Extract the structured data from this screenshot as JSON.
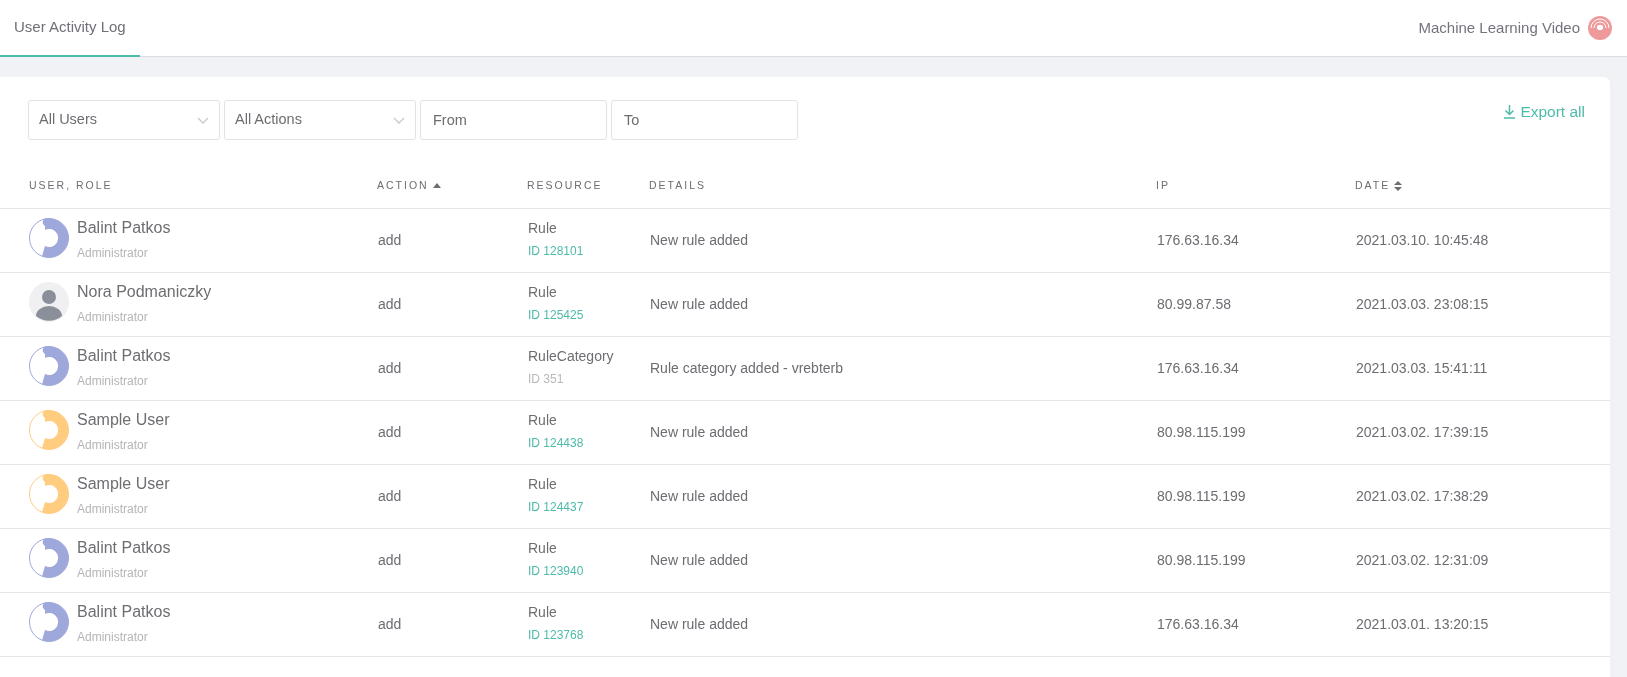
{
  "tabs": [
    {
      "label": "User Activity Log",
      "selected": true
    }
  ],
  "account": {
    "name": "Machine Learning Video"
  },
  "filters": {
    "user_select": "All Users",
    "action_select": "All Actions",
    "from": {
      "placeholder": "From"
    },
    "to": {
      "placeholder": "To"
    }
  },
  "export": {
    "label": "Export all"
  },
  "table": {
    "columns": [
      {
        "label": "USER, ROLE"
      },
      {
        "label": "ACTION",
        "sorted_asc": true
      },
      {
        "label": "RESOURCE"
      },
      {
        "label": "DETAILS"
      },
      {
        "label": "IP"
      },
      {
        "label": "DATE",
        "sortable": true
      }
    ],
    "rows": [
      {
        "avatar": {
          "kind": "pattern",
          "color": "#9fa8da"
        },
        "name": "Balint Patkos",
        "role": "Administrator",
        "action": "add",
        "resource": "Rule",
        "resource_id": "ID 128101",
        "id_linked": true,
        "details": "New rule added",
        "ip": "176.63.16.34",
        "date": "2021.03.10. 10:45:48"
      },
      {
        "avatar": {
          "kind": "photo",
          "color": "#8a8f99"
        },
        "name": "Nora Podmaniczky",
        "role": "Administrator",
        "action": "add",
        "resource": "Rule",
        "resource_id": "ID 125425",
        "id_linked": true,
        "details": "New rule added",
        "ip": "80.99.87.58",
        "date": "2021.03.03. 23:08:15"
      },
      {
        "avatar": {
          "kind": "pattern",
          "color": "#9fa8da"
        },
        "name": "Balint Patkos",
        "role": "Administrator",
        "action": "add",
        "resource": "RuleCategory",
        "resource_id": "ID 351",
        "id_linked": false,
        "details": "Rule category added - vrebterb",
        "ip": "176.63.16.34",
        "date": "2021.03.03. 15:41:11"
      },
      {
        "avatar": {
          "kind": "pattern",
          "color": "#ffcc80"
        },
        "name": "Sample User",
        "role": "Administrator",
        "action": "add",
        "resource": "Rule",
        "resource_id": "ID 124438",
        "id_linked": true,
        "details": "New rule added",
        "ip": "80.98.115.199",
        "date": "2021.03.02. 17:39:15"
      },
      {
        "avatar": {
          "kind": "pattern",
          "color": "#ffcc80"
        },
        "name": "Sample User",
        "role": "Administrator",
        "action": "add",
        "resource": "Rule",
        "resource_id": "ID 124437",
        "id_linked": true,
        "details": "New rule added",
        "ip": "80.98.115.199",
        "date": "2021.03.02. 17:38:29"
      },
      {
        "avatar": {
          "kind": "pattern",
          "color": "#9fa8da"
        },
        "name": "Balint Patkos",
        "role": "Administrator",
        "action": "add",
        "resource": "Rule",
        "resource_id": "ID 123940",
        "id_linked": true,
        "details": "New rule added",
        "ip": "80.98.115.199",
        "date": "2021.03.02. 12:31:09"
      },
      {
        "avatar": {
          "kind": "pattern",
          "color": "#9fa8da"
        },
        "name": "Balint Patkos",
        "role": "Administrator",
        "action": "add",
        "resource": "Rule",
        "resource_id": "ID 123768",
        "id_linked": true,
        "details": "New rule added",
        "ip": "176.63.16.34",
        "date": "2021.03.01. 13:20:15"
      }
    ]
  }
}
